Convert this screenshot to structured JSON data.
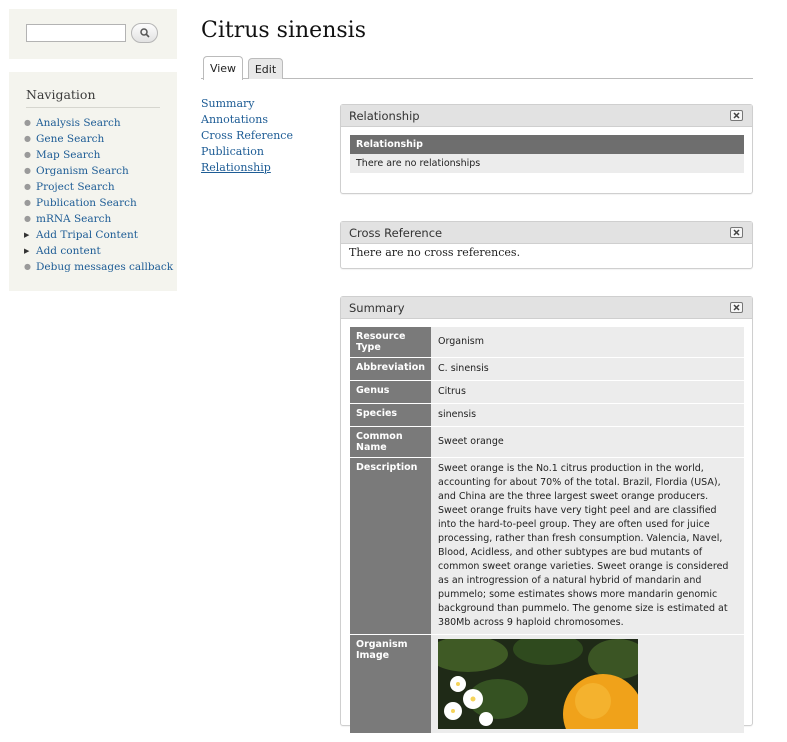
{
  "search": {
    "placeholder": "",
    "button_icon": "search-icon"
  },
  "navigation": {
    "title": "Navigation",
    "items": [
      {
        "label": "Analysis Search",
        "bullet": "circle"
      },
      {
        "label": "Gene Search",
        "bullet": "circle"
      },
      {
        "label": "Map Search",
        "bullet": "circle"
      },
      {
        "label": "Organism Search",
        "bullet": "circle"
      },
      {
        "label": "Project Search",
        "bullet": "circle"
      },
      {
        "label": "Publication Search",
        "bullet": "circle"
      },
      {
        "label": "mRNA Search",
        "bullet": "circle"
      },
      {
        "label": "Add Tripal Content",
        "bullet": "triangle"
      },
      {
        "label": "Add content",
        "bullet": "triangle"
      },
      {
        "label": "Debug messages callback",
        "bullet": "circle"
      }
    ]
  },
  "page": {
    "title": "Citrus sinensis"
  },
  "tabs": {
    "view": "View",
    "edit": "Edit"
  },
  "toc": [
    "Summary",
    "Annotations",
    "Cross Reference",
    "Publication",
    "Relationship"
  ],
  "relationship_panel": {
    "title": "Relationship",
    "table_header": "Relationship",
    "empty_text": "There are no relationships"
  },
  "cross_reference_panel": {
    "title": "Cross Reference",
    "empty_text": "There are no cross references."
  },
  "summary_panel": {
    "title": "Summary",
    "rows": {
      "resource_type": {
        "label": "Resource Type",
        "value": "Organism"
      },
      "abbreviation": {
        "label": "Abbreviation",
        "value": "C. sinensis"
      },
      "genus": {
        "label": "Genus",
        "value": "Citrus"
      },
      "species": {
        "label": "Species",
        "value": "sinensis"
      },
      "common_name": {
        "label": "Common Name",
        "value": "Sweet orange"
      },
      "description": {
        "label": "Description",
        "value": "Sweet orange is the No.1 citrus production in the world, accounting for about 70% of the total. Brazil, Flordia (USA), and China are the three largest sweet orange producers. Sweet orange fruits have very tight peel and are classified into the hard-to-peel group. They are often used for juice processing, rather than fresh consumption. Valencia, Navel, Blood, Acidless, and other subtypes are bud mutants of common sweet orange varieties. Sweet orange is considered as an introgression of a natural hybrid of mandarin and pummelo; some estimates shows more mandarin genomic background than pummelo. The genome size is estimated at 380Mb across 9 haploid chromosomes."
      },
      "organism_image": {
        "label": "Organism Image"
      }
    }
  },
  "colors": {
    "link": "#1d5c95",
    "header_cell": "#7a7a7a",
    "panel_head": "#e2e2e2",
    "sidebar_bg": "#f4f4ee"
  }
}
